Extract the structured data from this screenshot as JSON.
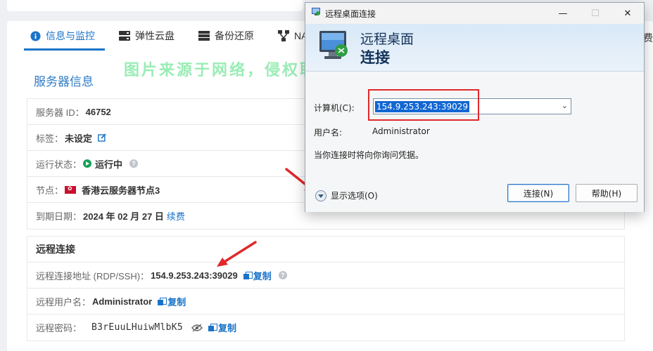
{
  "tabs": [
    {
      "label": "信息与监控",
      "icon": "info-icon"
    },
    {
      "label": "弹性云盘",
      "icon": "disk-icon"
    },
    {
      "label": "备份还原",
      "icon": "backup-icon"
    },
    {
      "label": "NAT转",
      "icon": "network-icon"
    }
  ],
  "tab_right_label": "费",
  "server_section": {
    "title": "服务器信息",
    "rows": {
      "server_id_label": "服务器 ID：",
      "server_id": "46752",
      "tag_label": "标签：",
      "tag": "未设定",
      "status_label": "运行状态：",
      "status": "运行中",
      "node_label": "节点：",
      "node": "香港云服务器节点3",
      "expire_label": "到期日期：",
      "expire": "2024 年 02 月 27 日",
      "renew": "续费"
    }
  },
  "rdp_section": {
    "title": "远程连接",
    "address_label": "远程连接地址 (RDP/SSH)：",
    "address": "154.9.253.243:39029",
    "username_label": "远程用户名：",
    "username": "Administrator",
    "password_label": "远程密码：",
    "password": "B3rEuuLHuiwMlbK5",
    "copy": "复制"
  },
  "watermark": "图片来源于网络，侵权联系站长删除！",
  "dialog": {
    "title": "远程桌面连接",
    "banner_line1": "远程桌面",
    "banner_line2": "连接",
    "computer_label": "计算机(C):",
    "computer_value": "154.9.253.243:39029",
    "user_label": "用户名:",
    "user_value": "Administrator",
    "hint": "当你连接时将向你询问凭据。",
    "options": "显示选项(O)",
    "connect": "连接(N)",
    "help": "帮助(H)",
    "minimize": "—",
    "maximize": "☐",
    "close": "✕"
  },
  "colors": {
    "accent": "#1a73c8",
    "status_green": "#18a058",
    "highlight_red": "#e0282a",
    "watermark": "#46dc78"
  }
}
